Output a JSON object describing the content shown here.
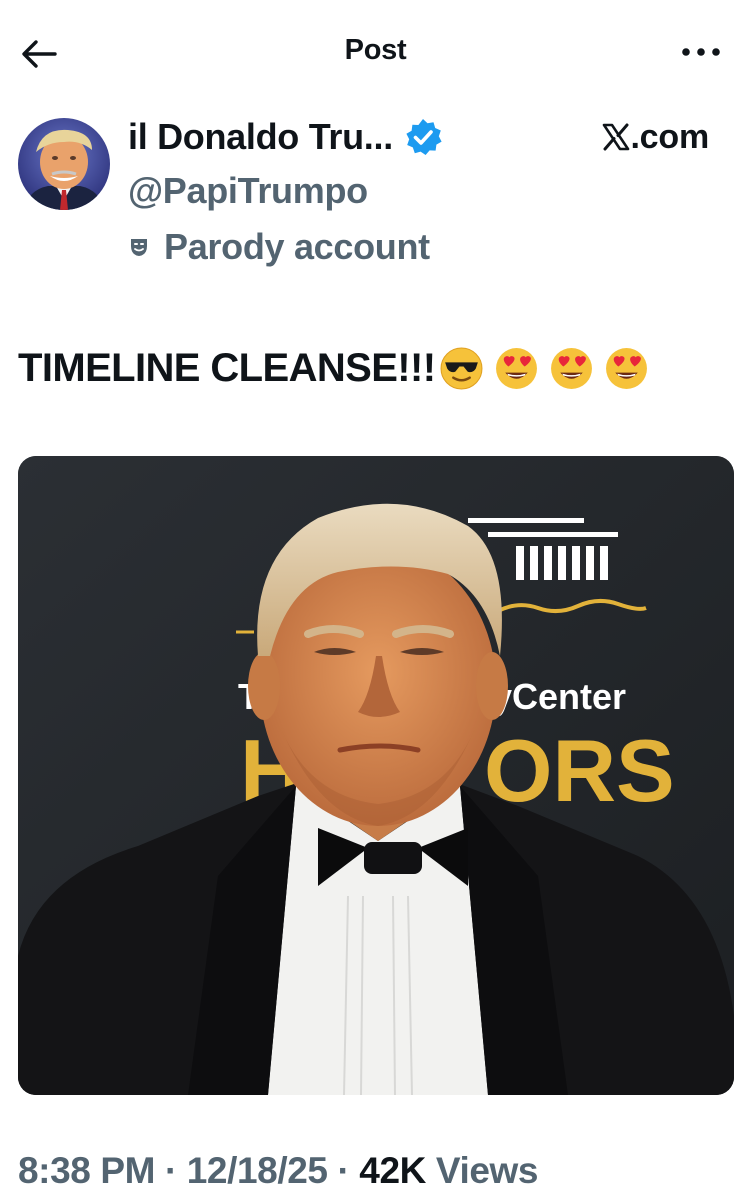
{
  "header": {
    "title": "Post",
    "back_icon": "arrow-left-icon",
    "more_icon": "more-horizontal-icon"
  },
  "author": {
    "display_name": "il Donaldo Tru...",
    "handle": "@PapiTrumpo",
    "parody_label": "Parody account",
    "verified_icon": "verified-badge-icon",
    "verified_color": "#1d9bf0",
    "parody_icon": "theater-mask-icon"
  },
  "source": {
    "label": ".com",
    "logo": "x-logo-icon"
  },
  "post": {
    "text": "TIMELINE CLEANSE!!!",
    "emojis": [
      "smiling-face-with-sunglasses",
      "smiling-face-with-heart-eyes",
      "smiling-face-with-heart-eyes",
      "smiling-face-with-heart-eyes"
    ]
  },
  "media": {
    "backdrop_text_center": "Center",
    "backdrop_text_honors": "ORS",
    "backdrop_text_fragment": "T",
    "backdrop_text_fragment2": "y",
    "backdrop_honors_fragment": "H"
  },
  "footer": {
    "time": "8:38 PM",
    "separator": "·",
    "date": "12/18/25",
    "views_count": "42K",
    "views_label": "Views"
  },
  "colors": {
    "text_primary": "#0f1419",
    "text_secondary": "#536471",
    "gold": "#e2b23a"
  }
}
